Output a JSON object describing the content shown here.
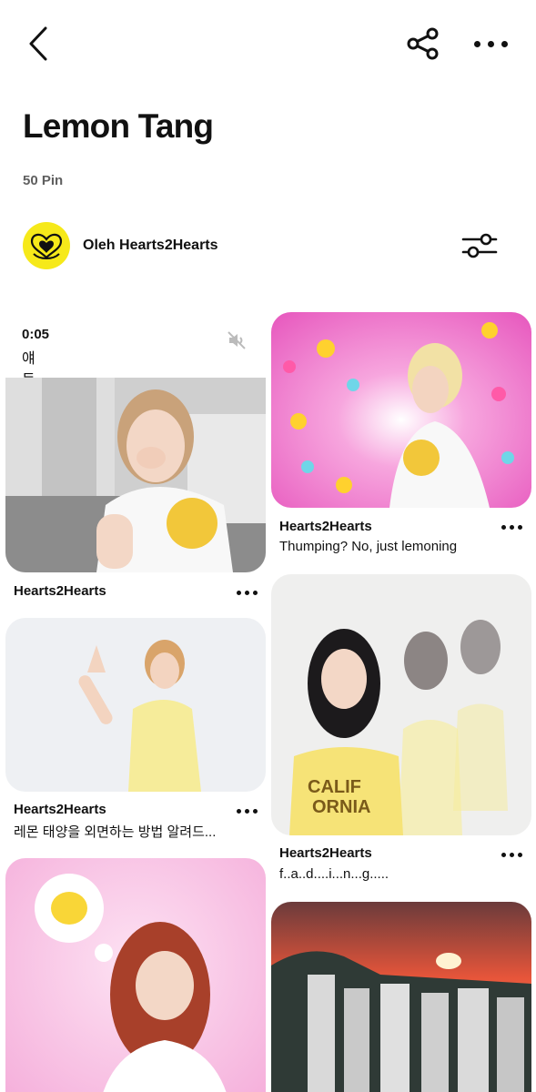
{
  "header": {
    "back_icon": "chevron-left-icon",
    "share_icon": "share-icon",
    "more_icon": "more-horizontal-icon"
  },
  "board": {
    "title": "Lemon Tang",
    "pin_count": "50 Pin",
    "owner_label": "Oleh Hearts2Hearts",
    "filter_icon": "sliders-icon"
  },
  "pins": [
    {
      "video_time": "0:05",
      "caption": "얘들아 여기가 어디야",
      "mute_icon": "volume-mute-icon",
      "name": "Hearts2Hearts",
      "description": ""
    },
    {
      "name": "Hearts2Hearts",
      "description": "Thumping? No, just lemoning"
    },
    {
      "name": "Hearts2Hearts",
      "description": "레몬 태양을 외면하는 방법 알려드..."
    },
    {
      "name": "Hearts2Hearts",
      "description": "f..a..d....i...n...g....."
    },
    {
      "name": "",
      "description": ""
    },
    {
      "name": "",
      "description": ""
    }
  ],
  "colors": {
    "avatar_bg": "#f6e91a",
    "text": "#111111",
    "muted": "#5f5f5f"
  }
}
